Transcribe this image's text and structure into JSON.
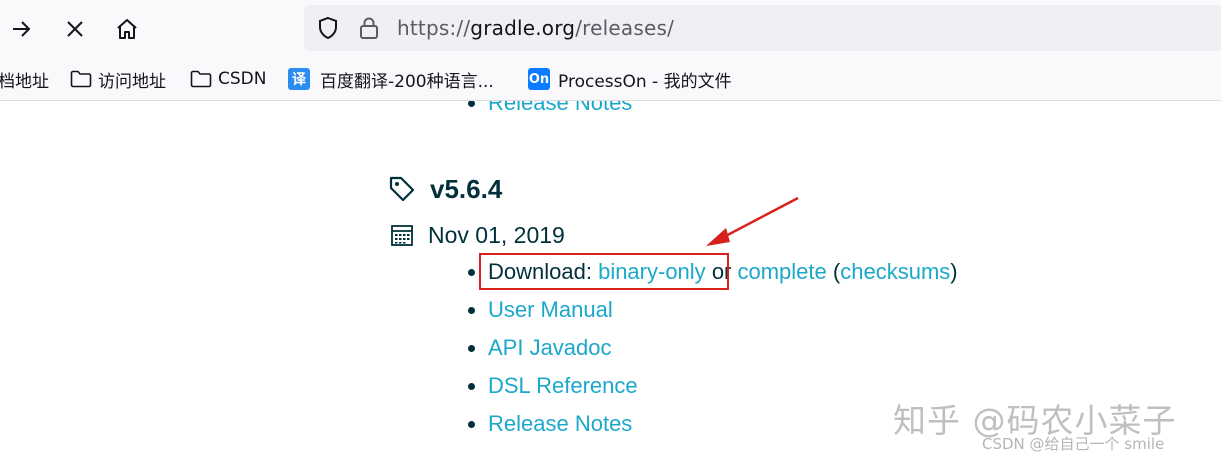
{
  "browser": {
    "url": {
      "prefix": "https://",
      "host": "gradle.org",
      "path": "/releases/"
    },
    "bookmarks": [
      {
        "label": "档地址",
        "icon": "folder-icon"
      },
      {
        "label": "访问地址",
        "icon": "folder-icon"
      },
      {
        "label": "CSDN",
        "icon": "folder-icon"
      },
      {
        "label": "百度翻译-200种语言...",
        "icon": "translate-icon",
        "badge": "译",
        "color": "#2d8cf0"
      },
      {
        "label": "ProcessOn - 我的文件",
        "icon": "processon-icon",
        "badge": "On",
        "color": "#0b7bff"
      }
    ]
  },
  "release_top": {
    "last_item": "Release Notes"
  },
  "release": {
    "version": "v5.6.4",
    "date": "Nov 01, 2019",
    "download": {
      "label": "Download:",
      "binary": "binary-only",
      "or": "or",
      "complete": "complete",
      "open_paren": "(",
      "checksums": "checksums",
      "close_paren": ")"
    },
    "links": [
      "User Manual",
      "API Javadoc",
      "DSL Reference",
      "Release Notes"
    ]
  },
  "colors": {
    "link": "#1ba8cb",
    "text": "#02303a",
    "annotation": "#d9201d"
  },
  "watermarks": {
    "zhihu": "知乎 @码农小菜子",
    "csdn": "CSDN @给自己一个 smile"
  }
}
